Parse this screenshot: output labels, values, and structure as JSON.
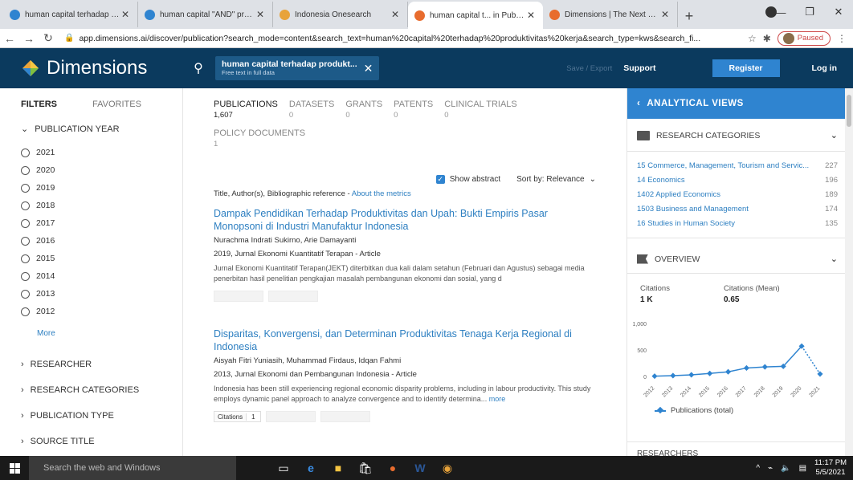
{
  "browser": {
    "tabs": [
      {
        "title": "human capital terhadap prod",
        "color": "#2f84d0",
        "active": false
      },
      {
        "title": "human capital \"AND\" produk",
        "color": "#2f84d0",
        "active": false
      },
      {
        "title": "Indonesia Onesearch",
        "color": "#e8a33a",
        "active": false
      },
      {
        "title": "human capital t... in Publicati",
        "color": "#e86c2e",
        "active": true
      },
      {
        "title": "Dimensions | The Next Evolut",
        "color": "#e86c2e",
        "active": false
      }
    ],
    "url": "app.dimensions.ai/discover/publication?search_mode=content&search_text=human%20capital%20terhadap%20produktivitas%20kerja&search_type=kws&search_fi...",
    "paused_label": "Paused"
  },
  "header": {
    "logo_text": "Dimensions",
    "query_text": "human capital terhadap produkt...",
    "query_sub": "Free text in full data",
    "save_export": "Save / Export",
    "support": "Support",
    "register": "Register",
    "login": "Log in"
  },
  "filters": {
    "tab_filters": "FILTERS",
    "tab_favorites": "FAVORITES",
    "publication_year_label": "PUBLICATION YEAR",
    "years": [
      "2021",
      "2020",
      "2019",
      "2018",
      "2017",
      "2016",
      "2015",
      "2014",
      "2013",
      "2012"
    ],
    "more": "More",
    "sections": [
      "RESEARCHER",
      "RESEARCH CATEGORIES",
      "PUBLICATION TYPE",
      "SOURCE TITLE"
    ]
  },
  "results": {
    "tabs": [
      {
        "label": "PUBLICATIONS",
        "count": "1,607",
        "active": true
      },
      {
        "label": "DATASETS",
        "count": "0",
        "active": false
      },
      {
        "label": "GRANTS",
        "count": "0",
        "active": false
      },
      {
        "label": "PATENTS",
        "count": "0",
        "active": false
      },
      {
        "label": "CLINICAL TRIALS",
        "count": "0",
        "active": false
      }
    ],
    "policy_label": "POLICY DOCUMENTS",
    "policy_count": "1",
    "show_abstract": "Show abstract",
    "sort_by": "Sort by: Relevance",
    "metrics_prefix": "Title, Author(s), Bibliographic reference - ",
    "metrics_link": "About the metrics",
    "items": [
      {
        "title": "Dampak Pendidikan Terhadap Produktivitas dan Upah: Bukti Empiris Pasar Monopsoni di Industri Manufaktur Indonesia",
        "authors": "Nurachma Indrati Sukirno, Arie Damayanti",
        "source": "2019, Jurnal Ekonomi Kuantitatif Terapan - Article",
        "abstract": "Jurnal Ekonomi Kuantitatif Terapan(JEKT) diterbitkan dua kali dalam setahun (Februari dan Agustus) sebagai media penerbitan hasil penelitian pengkajian masalah pembangunan ekonomi dan sosial, yang d"
      },
      {
        "title": "Disparitas, Konvergensi, dan Determinan Produktivitas Tenaga Kerja Regional di Indonesia",
        "authors": "Aisyah Fitri Yuniasih, Muhammad Firdaus, Idqan Fahmi",
        "source": "2013, Jurnal Ekonomi dan Pembangunan Indonesia - Article",
        "abstract": "Indonesia has been still experiencing regional economic disparity problems, including in labour productivity. This study employs dynamic panel approach to analyze convergence and to identify determina... ",
        "more": "more",
        "citations_label": "Citations",
        "citations_value": "1"
      }
    ]
  },
  "analytical": {
    "title": "ANALYTICAL VIEWS",
    "research_categories_label": "RESEARCH CATEGORIES",
    "categories": [
      {
        "name": "15 Commerce, Management, Tourism and Servic...",
        "count": "227"
      },
      {
        "name": "14 Economics",
        "count": "196"
      },
      {
        "name": "1402 Applied Economics",
        "count": "189"
      },
      {
        "name": "1503 Business and Management",
        "count": "174"
      },
      {
        "name": "16 Studies in Human Society",
        "count": "135"
      }
    ],
    "overview_label": "OVERVIEW",
    "citations_label": "Citations",
    "citations_value": "1 K",
    "citations_mean_label": "Citations (Mean)",
    "citations_mean_value": "0.65",
    "legend": "Publications (total)",
    "researchers_label": "RESEARCHERS"
  },
  "chart_data": {
    "type": "line",
    "x": [
      "2012",
      "2013",
      "2014",
      "2015",
      "2016",
      "2017",
      "2018",
      "2019",
      "2020",
      "2021"
    ],
    "series": [
      {
        "name": "Publications (total)",
        "values": [
          20,
          30,
          45,
          70,
          100,
          170,
          190,
          200,
          570,
          60
        ]
      }
    ],
    "yticks": [
      "1,000",
      "500",
      "0"
    ],
    "ylim": [
      0,
      1000
    ],
    "color": "#2f84d0"
  },
  "taskbar": {
    "search_placeholder": "Search the web and Windows",
    "time": "11:17 PM",
    "date": "5/5/2021"
  }
}
